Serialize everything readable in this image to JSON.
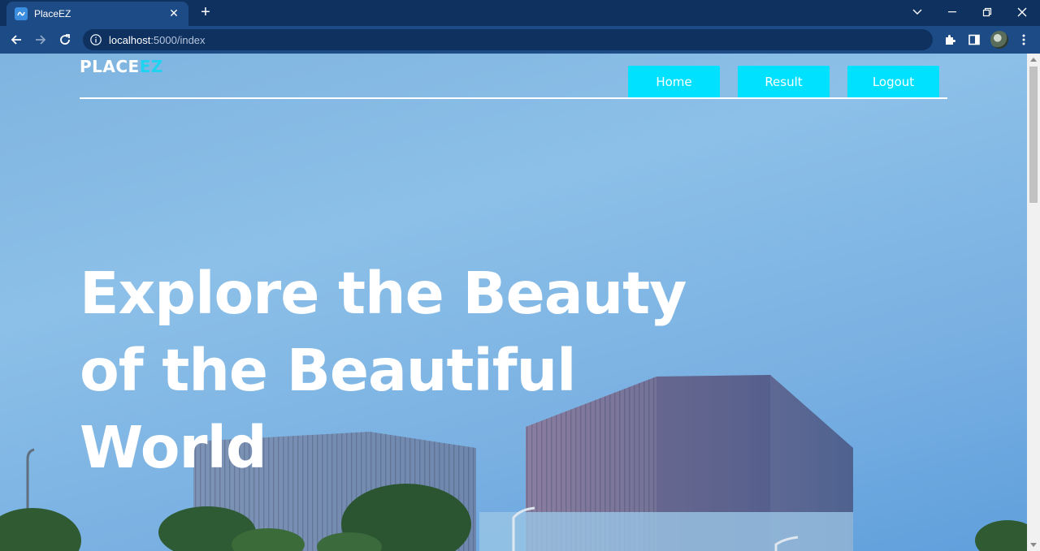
{
  "browser": {
    "tab_title": "PlaceEZ",
    "tab_close": "✕",
    "new_tab": "+",
    "url_host": "localhost",
    "url_path": ":5000/index"
  },
  "header": {
    "logo_primary": "PLACE",
    "logo_accent": "EZ",
    "nav": [
      {
        "label": "Home"
      },
      {
        "label": "Result"
      },
      {
        "label": "Logout"
      }
    ]
  },
  "hero": {
    "lines": [
      "Explore the Beauty",
      "of the Beautiful",
      "World"
    ]
  },
  "colors": {
    "chrome_dark": "#0e3160",
    "chrome_toolbar": "#1d4b86",
    "accent_cyan": "#00e0ff",
    "logo_accent": "#1fd3f0",
    "sky": "#8cc0e8"
  },
  "icons": {
    "back": "arrow-left-icon",
    "forward": "arrow-right-icon",
    "reload": "reload-icon",
    "info": "info-icon",
    "share": "share-icon",
    "bookmark": "star-icon",
    "extensions": "puzzle-icon",
    "side_panel": "side-panel-icon",
    "menu": "kebab-menu-icon"
  }
}
